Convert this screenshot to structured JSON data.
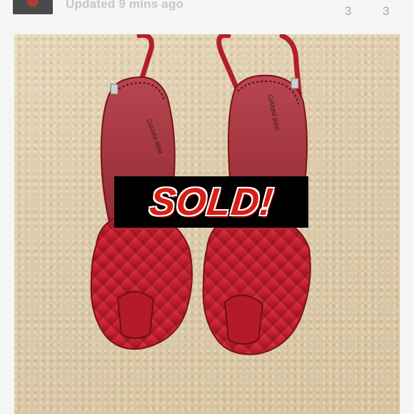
{
  "header": {
    "updated_text": "Updated 9 mins ago",
    "count_left": "3",
    "count_right": "3"
  },
  "listing_image": {
    "banner_text": "SOLD!",
    "banner_color": "#d71f16",
    "shoe_color": "#c2202c",
    "background_color": "#dccaa9"
  }
}
